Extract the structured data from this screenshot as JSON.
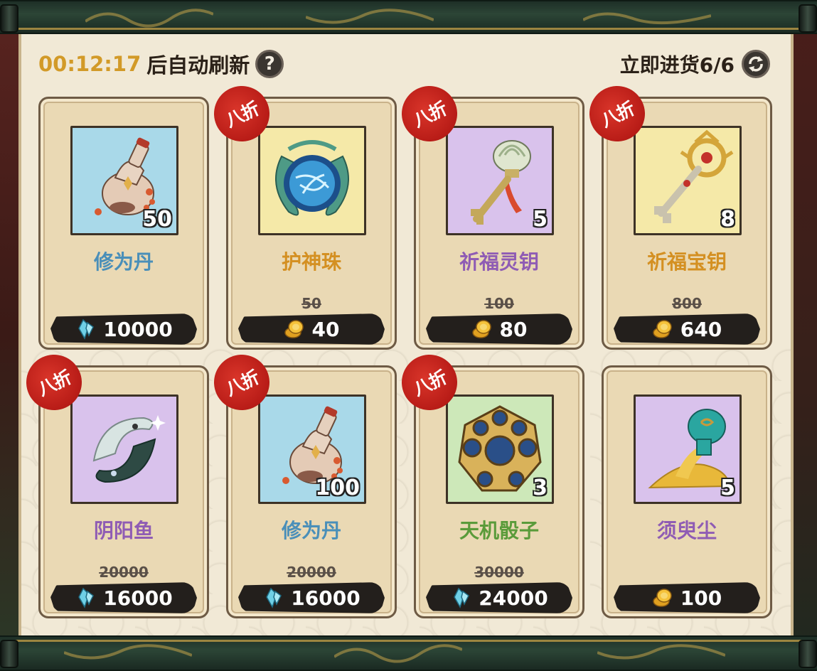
{
  "header": {
    "timer": "00:12:17",
    "refresh_text": "后自动刷新",
    "help_icon": "?",
    "restock_text": "立即进货6/6"
  },
  "items": [
    {
      "name": "修为丹",
      "qty": "50",
      "price": "10000",
      "old_price": "",
      "currency": "crystal-icon",
      "discount": "",
      "icon": "potion-icon",
      "bg": "blue",
      "name_color": "blue"
    },
    {
      "name": "护神珠",
      "qty": "",
      "price": "40",
      "old_price": "50",
      "currency": "gold-coin-icon",
      "discount": "八折",
      "icon": "orb-icon",
      "bg": "yellow",
      "name_color": "orange"
    },
    {
      "name": "祈福灵钥",
      "qty": "5",
      "price": "80",
      "old_price": "100",
      "currency": "gold-coin-icon",
      "discount": "八折",
      "icon": "lotus-key-icon",
      "bg": "purple",
      "name_color": "purple"
    },
    {
      "name": "祈福宝钥",
      "qty": "8",
      "price": "640",
      "old_price": "800",
      "currency": "gold-coin-icon",
      "discount": "八折",
      "icon": "golden-key-icon",
      "bg": "yellow",
      "name_color": "orange"
    },
    {
      "name": "阴阳鱼",
      "qty": "",
      "price": "16000",
      "old_price": "20000",
      "currency": "crystal-icon",
      "discount": "八折",
      "icon": "yin-yang-fish-icon",
      "bg": "purple",
      "name_color": "purple"
    },
    {
      "name": "修为丹",
      "qty": "100",
      "price": "16000",
      "old_price": "20000",
      "currency": "crystal-icon",
      "discount": "八折",
      "icon": "potion-icon",
      "bg": "blue",
      "name_color": "blue"
    },
    {
      "name": "天机骰子",
      "qty": "3",
      "price": "24000",
      "old_price": "30000",
      "currency": "crystal-icon",
      "discount": "八折",
      "icon": "dice-icon",
      "bg": "green",
      "name_color": "green"
    },
    {
      "name": "须臾尘",
      "qty": "5",
      "price": "100",
      "old_price": "",
      "currency": "gold-coin-icon",
      "discount": "",
      "icon": "sand-bottle-icon",
      "bg": "purple",
      "name_color": "purple"
    }
  ],
  "colors": {
    "timer": "#d29a28",
    "discount_badge": "#c4221c",
    "panel": "#f1e9d6"
  }
}
